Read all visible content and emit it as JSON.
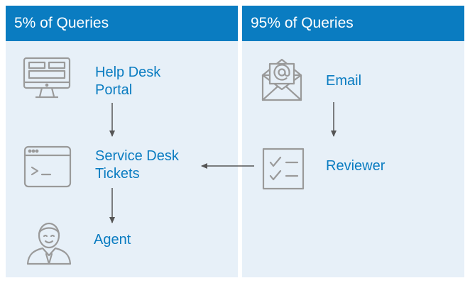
{
  "left_panel": {
    "title": "5% of Queries",
    "nodes": {
      "help_desk_portal": {
        "line1": "Help Desk",
        "line2": "Portal",
        "icon": "desktop-monitor-icon"
      },
      "service_desk_tickets": {
        "line1": "Service Desk",
        "line2": "Tickets",
        "icon": "terminal-window-icon"
      },
      "agent": {
        "label": "Agent",
        "icon": "agent-person-icon"
      }
    }
  },
  "right_panel": {
    "title": "95% of Queries",
    "nodes": {
      "email": {
        "label": "Email",
        "icon": "email-envelope-icon"
      },
      "reviewer": {
        "label": "Reviewer",
        "icon": "checklist-icon"
      }
    }
  },
  "colors": {
    "header": "#0a7cc1",
    "panel": "#e7f0f8",
    "label": "#0a7cc1",
    "icon": "#9a9a9a",
    "arrow": "#555555"
  }
}
